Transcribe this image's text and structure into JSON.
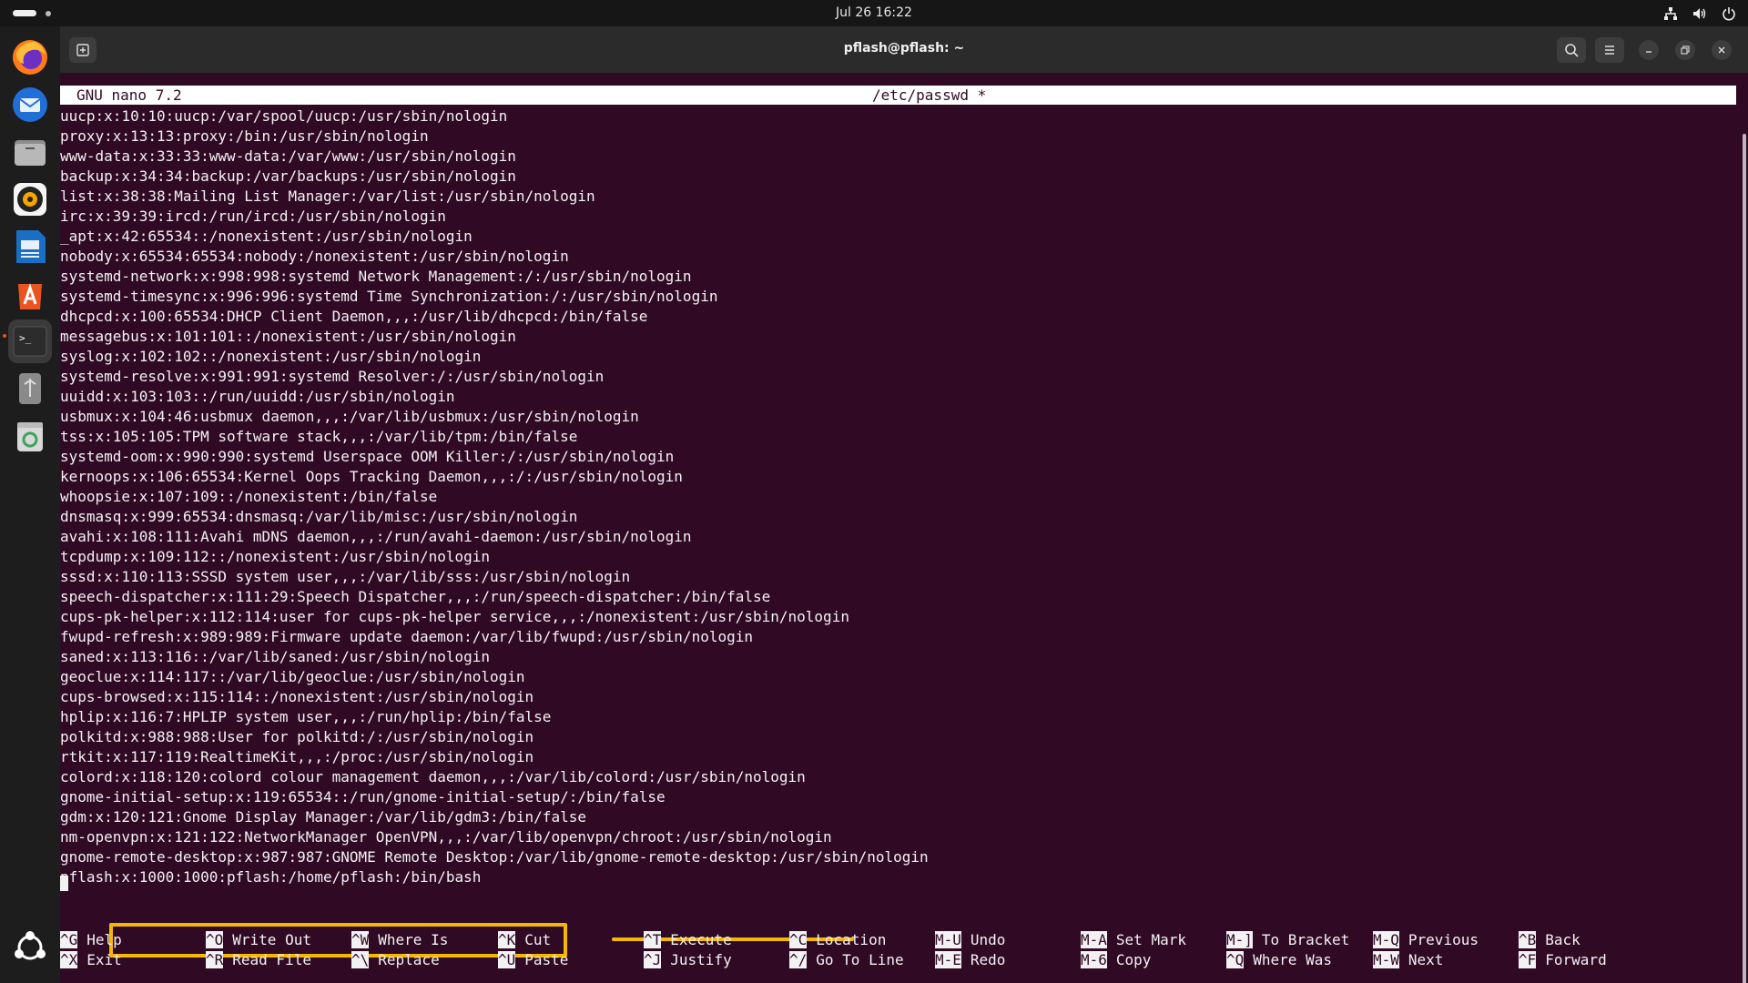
{
  "topbar": {
    "clock": "Jul 26  16:22"
  },
  "window": {
    "title": "pflash@pflash: ~"
  },
  "nano": {
    "version": "GNU nano 7.2",
    "filename": "/etc/passwd *",
    "lines": [
      "uucp:x:10:10:uucp:/var/spool/uucp:/usr/sbin/nologin",
      "proxy:x:13:13:proxy:/bin:/usr/sbin/nologin",
      "www-data:x:33:33:www-data:/var/www:/usr/sbin/nologin",
      "backup:x:34:34:backup:/var/backups:/usr/sbin/nologin",
      "list:x:38:38:Mailing List Manager:/var/list:/usr/sbin/nologin",
      "irc:x:39:39:ircd:/run/ircd:/usr/sbin/nologin",
      "_apt:x:42:65534::/nonexistent:/usr/sbin/nologin",
      "nobody:x:65534:65534:nobody:/nonexistent:/usr/sbin/nologin",
      "systemd-network:x:998:998:systemd Network Management:/:/usr/sbin/nologin",
      "systemd-timesync:x:996:996:systemd Time Synchronization:/:/usr/sbin/nologin",
      "dhcpcd:x:100:65534:DHCP Client Daemon,,,:/usr/lib/dhcpcd:/bin/false",
      "messagebus:x:101:101::/nonexistent:/usr/sbin/nologin",
      "syslog:x:102:102::/nonexistent:/usr/sbin/nologin",
      "systemd-resolve:x:991:991:systemd Resolver:/:/usr/sbin/nologin",
      "uuidd:x:103:103::/run/uuidd:/usr/sbin/nologin",
      "usbmux:x:104:46:usbmux daemon,,,:/var/lib/usbmux:/usr/sbin/nologin",
      "tss:x:105:105:TPM software stack,,,:/var/lib/tpm:/bin/false",
      "systemd-oom:x:990:990:systemd Userspace OOM Killer:/:/usr/sbin/nologin",
      "kernoops:x:106:65534:Kernel Oops Tracking Daemon,,,:/:/usr/sbin/nologin",
      "whoopsie:x:107:109::/nonexistent:/bin/false",
      "dnsmasq:x:999:65534:dnsmasq:/var/lib/misc:/usr/sbin/nologin",
      "avahi:x:108:111:Avahi mDNS daemon,,,:/run/avahi-daemon:/usr/sbin/nologin",
      "tcpdump:x:109:112::/nonexistent:/usr/sbin/nologin",
      "sssd:x:110:113:SSSD system user,,,:/var/lib/sss:/usr/sbin/nologin",
      "speech-dispatcher:x:111:29:Speech Dispatcher,,,:/run/speech-dispatcher:/bin/false",
      "cups-pk-helper:x:112:114:user for cups-pk-helper service,,,:/nonexistent:/usr/sbin/nologin",
      "fwupd-refresh:x:989:989:Firmware update daemon:/var/lib/fwupd:/usr/sbin/nologin",
      "saned:x:113:116::/var/lib/saned:/usr/sbin/nologin",
      "geoclue:x:114:117::/var/lib/geoclue:/usr/sbin/nologin",
      "cups-browsed:x:115:114::/nonexistent:/usr/sbin/nologin",
      "hplip:x:116:7:HPLIP system user,,,:/run/hplip:/bin/false",
      "polkitd:x:988:988:User for polkitd:/:/usr/sbin/nologin",
      "rtkit:x:117:119:RealtimeKit,,,:/proc:/usr/sbin/nologin",
      "colord:x:118:120:colord colour management daemon,,,:/var/lib/colord:/usr/sbin/nologin",
      "gnome-initial-setup:x:119:65534::/run/gnome-initial-setup/:/bin/false",
      "gdm:x:120:121:Gnome Display Manager:/var/lib/gdm3:/bin/false",
      "nm-openvpn:x:121:122:NetworkManager OpenVPN,,,:/var/lib/openvpn/chroot:/usr/sbin/nologin",
      "gnome-remote-desktop:x:987:987:GNOME Remote Desktop:/var/lib/gnome-remote-desktop:/usr/sbin/nologin",
      "pflash:x:1000:1000:pflash:/home/pflash:/bin/bash"
    ],
    "shortcuts": [
      [
        {
          "key": "^G",
          "label": "Help"
        },
        {
          "key": "^X",
          "label": "Exit"
        }
      ],
      [
        {
          "key": "^O",
          "label": "Write Out"
        },
        {
          "key": "^R",
          "label": "Read File"
        }
      ],
      [
        {
          "key": "^W",
          "label": "Where Is"
        },
        {
          "key": "^\\",
          "label": "Replace"
        }
      ],
      [
        {
          "key": "^K",
          "label": "Cut"
        },
        {
          "key": "^U",
          "label": "Paste"
        }
      ],
      [
        {
          "key": "^T",
          "label": "Execute"
        },
        {
          "key": "^J",
          "label": "Justify"
        }
      ],
      [
        {
          "key": "^C",
          "label": "Location"
        },
        {
          "key": "^/",
          "label": "Go To Line"
        }
      ],
      [
        {
          "key": "M-U",
          "label": "Undo"
        },
        {
          "key": "M-E",
          "label": "Redo"
        }
      ],
      [
        {
          "key": "M-A",
          "label": "Set Mark"
        },
        {
          "key": "M-6",
          "label": "Copy"
        }
      ],
      [
        {
          "key": "M-]",
          "label": "To Bracket"
        },
        {
          "key": "^Q",
          "label": "Where Was"
        }
      ],
      [
        {
          "key": "M-Q",
          "label": "Previous"
        },
        {
          "key": "M-W",
          "label": "Next"
        }
      ],
      [
        {
          "key": "^B",
          "label": "Back"
        },
        {
          "key": "^F",
          "label": "Forward"
        }
      ]
    ]
  },
  "dock": {
    "apps": [
      "firefox-icon",
      "thunderbird-icon",
      "files-icon",
      "rhythmbox-icon",
      "writer-icon",
      "app-center-icon",
      "terminal-icon",
      "usb-drive-icon",
      "trash-icon",
      "show-apps-icon"
    ]
  },
  "colors": {
    "terminal_bg": "#300a24",
    "highlight": "#f5b800",
    "accent": "#e95420"
  }
}
